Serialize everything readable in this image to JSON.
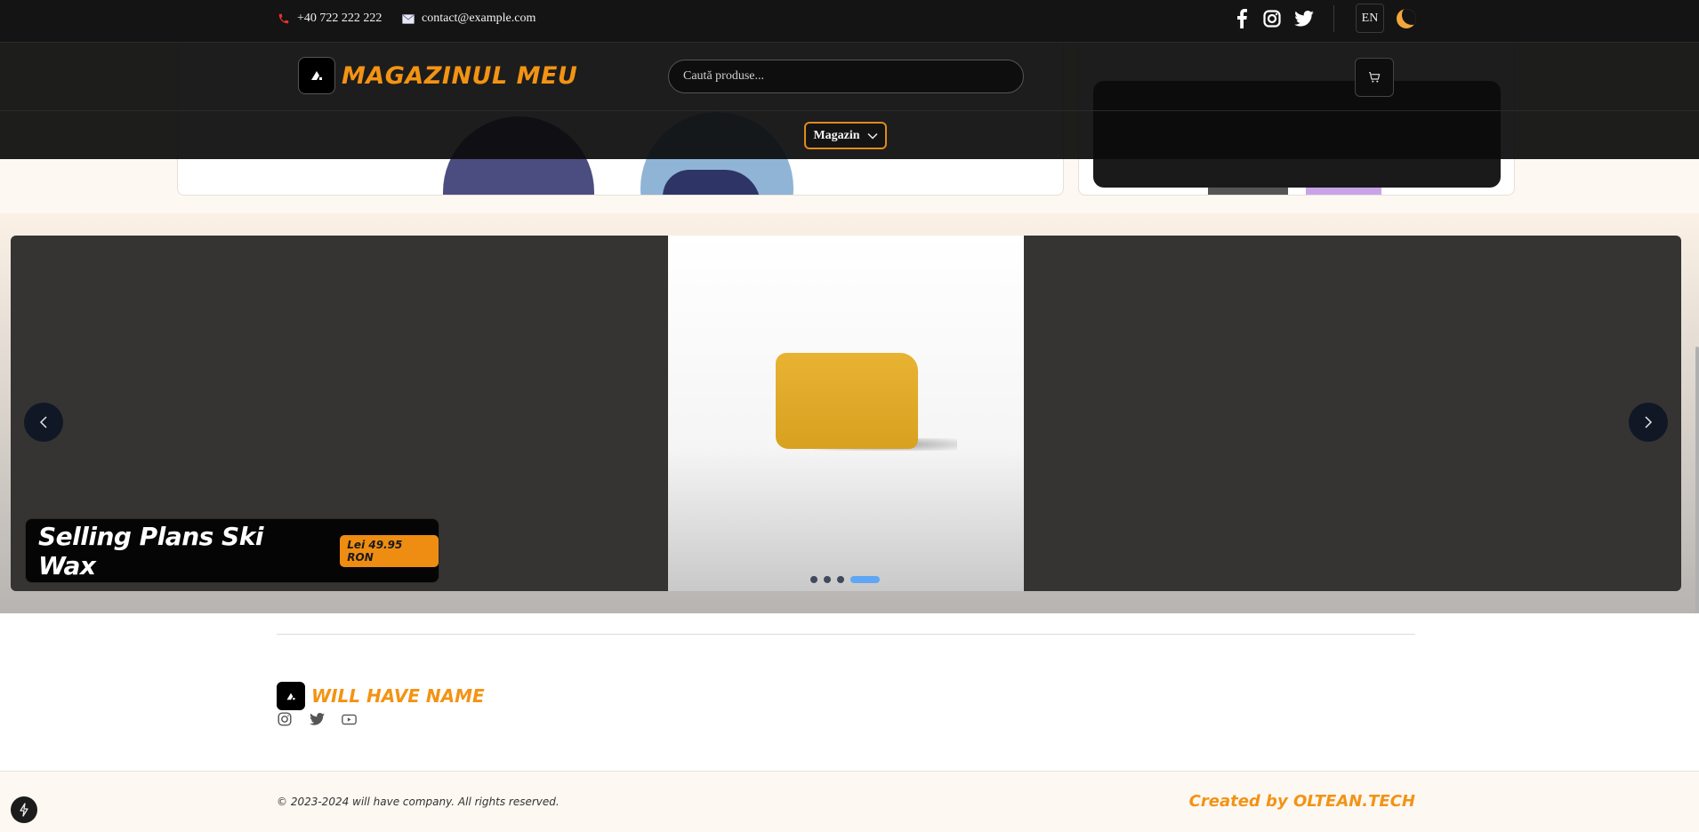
{
  "topbar": {
    "phone": "+40 722 222 222",
    "email": "contact@example.com",
    "language": "EN",
    "social_icons": [
      "facebook-icon",
      "instagram-icon",
      "twitter-icon"
    ],
    "theme_icon": "moon-icon"
  },
  "header": {
    "brand": "Magazinul meu",
    "search_placeholder": "Caută produse...",
    "cart_icon": "cart-icon"
  },
  "nav": {
    "menu_label": "Magazin"
  },
  "carousel": {
    "product_title": "Selling Plans Ski Wax",
    "price": "Lei 49.95 RON",
    "slide_count": 4,
    "active_slide": 4
  },
  "footer": {
    "brand": "will have name",
    "social_icons": [
      "instagram-icon",
      "twitter-icon",
      "youtube-icon"
    ],
    "copyright": "© 2023-2024 will have company. All rights reserved.",
    "credit": "Created by OLTEAN.TECH"
  },
  "colors": {
    "accent": "#f39314",
    "dark": "#141414",
    "dot_active": "#5fa6f5"
  }
}
